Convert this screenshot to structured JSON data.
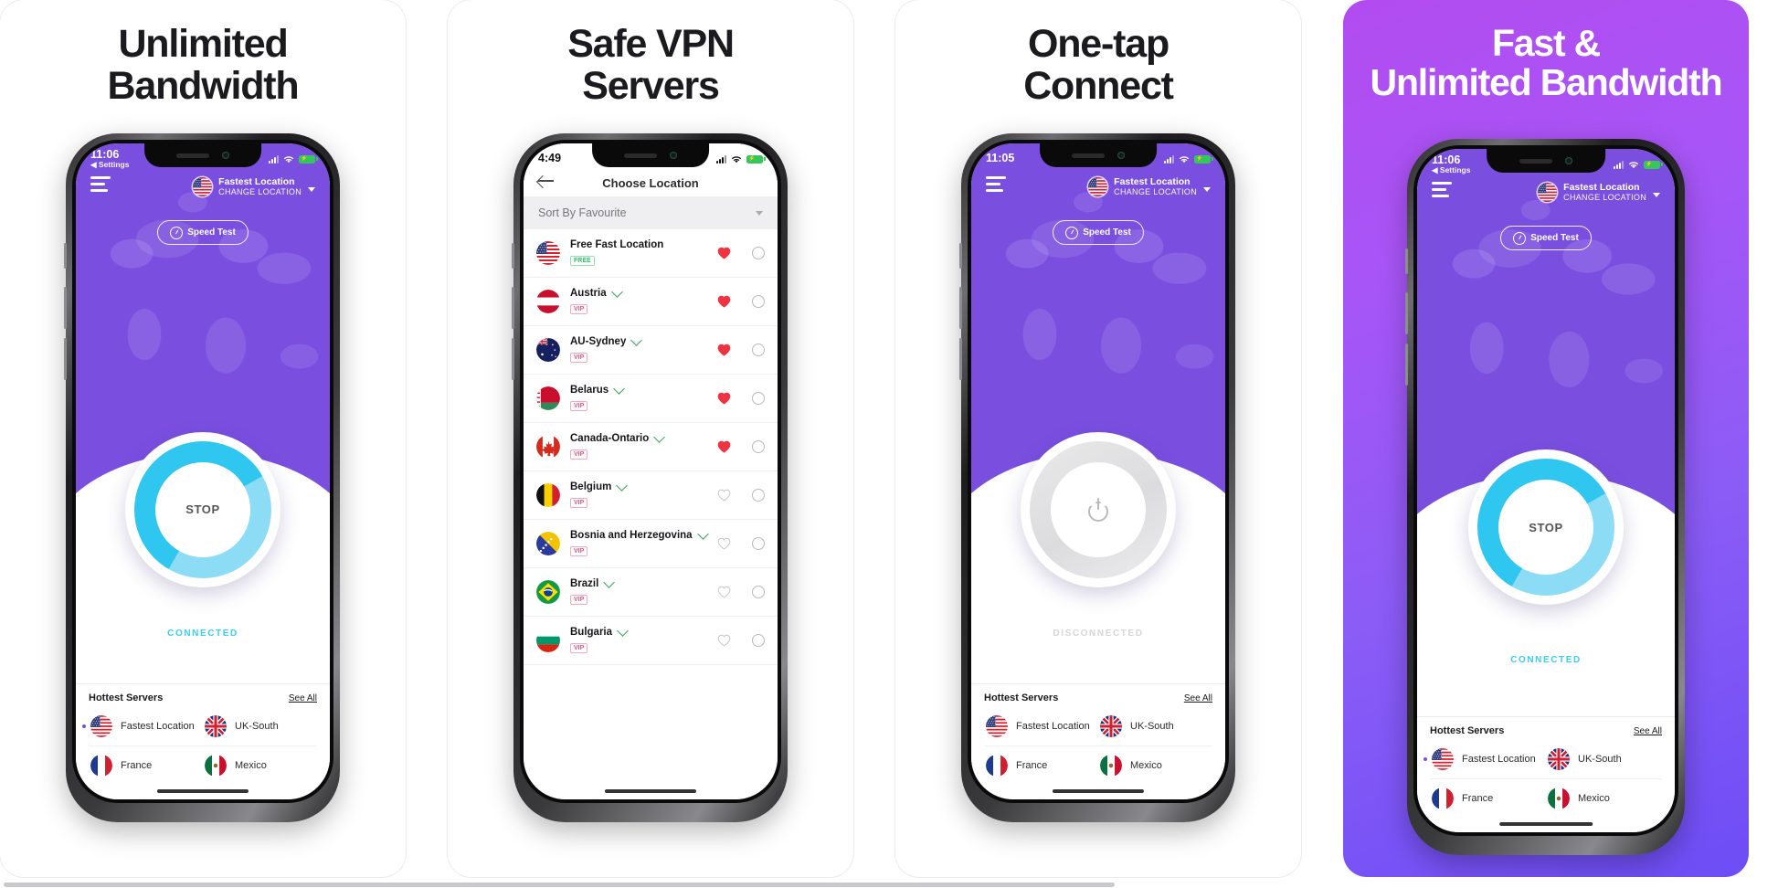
{
  "gallery": {
    "panels": [
      {
        "headline": "Unlimited\nBandwidth",
        "headline_line1": "Unlimited",
        "headline_line2": "Bandwidth",
        "screen_type": "vpn-home",
        "theme": "light",
        "status": {
          "time": "11:06",
          "back_label": "Settings",
          "battery": "charging"
        },
        "header": {
          "location_title": "Fastest Location",
          "location_sub": "CHANGE LOCATION",
          "flag": "us-flag-icon"
        },
        "speed_test_label": "Speed Test",
        "power_button_label": "STOP",
        "connection_status": "CONNECTED",
        "connection_state": "on",
        "hottest": {
          "title": "Hottest Servers",
          "see_all": "See All",
          "items": [
            {
              "name": "Fastest Location",
              "flag": "us-flag-icon",
              "active": true
            },
            {
              "name": "UK-South",
              "flag": "uk-flag-icon",
              "active": false
            },
            {
              "name": "France",
              "flag": "fr-flag-icon",
              "active": false
            },
            {
              "name": "Mexico",
              "flag": "mx-flag-icon",
              "active": false
            }
          ]
        }
      },
      {
        "headline_line1": "Safe VPN",
        "headline_line2": "Servers",
        "screen_type": "choose-location",
        "theme": "light",
        "status": {
          "time": "4:49",
          "back_label": "",
          "battery": "charging"
        },
        "nav_title": "Choose Location",
        "back_icon": "back-arrow-icon",
        "sort_label": "Sort By Favourite",
        "rows": [
          {
            "name": "Free Fast Location",
            "flag": "us-flag-icon",
            "badge": "FREE",
            "badge_type": "free",
            "chevron": false,
            "favourite": true
          },
          {
            "name": "Austria",
            "flag": "at-flag-icon",
            "badge": "VIP",
            "badge_type": "vip",
            "chevron": true,
            "favourite": true
          },
          {
            "name": "AU-Sydney",
            "flag": "au-flag-icon",
            "badge": "VIP",
            "badge_type": "vip",
            "chevron": true,
            "favourite": true
          },
          {
            "name": "Belarus",
            "flag": "by-flag-icon",
            "badge": "VIP",
            "badge_type": "vip",
            "chevron": true,
            "favourite": true
          },
          {
            "name": "Canada-Ontario",
            "flag": "ca-flag-icon",
            "badge": "VIP",
            "badge_type": "vip",
            "chevron": true,
            "favourite": true
          },
          {
            "name": "Belgium",
            "flag": "be-flag-icon",
            "badge": "VIP",
            "badge_type": "vip",
            "chevron": true,
            "favourite": false
          },
          {
            "name": "Bosnia and Herzegovina",
            "flag": "ba-flag-icon",
            "badge": "VIP",
            "badge_type": "vip",
            "chevron": true,
            "favourite": false
          },
          {
            "name": "Brazil",
            "flag": "br-flag-icon",
            "badge": "VIP",
            "badge_type": "vip",
            "chevron": true,
            "favourite": false
          },
          {
            "name": "Bulgaria",
            "flag": "bg-flag-icon",
            "badge": "VIP",
            "badge_type": "vip",
            "chevron": true,
            "favourite": false
          }
        ]
      },
      {
        "headline_line1": "One-tap",
        "headline_line2": "Connect",
        "screen_type": "vpn-home",
        "theme": "light",
        "status": {
          "time": "11:05",
          "back_label": "",
          "battery": "charging"
        },
        "header": {
          "location_title": "Fastest Location",
          "location_sub": "CHANGE LOCATION",
          "flag": "us-flag-icon"
        },
        "speed_test_label": "Speed Test",
        "power_button_label": "",
        "connection_status": "DISCONNECTED",
        "connection_state": "off",
        "hottest": {
          "title": "Hottest Servers",
          "see_all": "See All",
          "items": [
            {
              "name": "Fastest Location",
              "flag": "us-flag-icon",
              "active": false
            },
            {
              "name": "UK-South",
              "flag": "uk-flag-icon",
              "active": false
            },
            {
              "name": "France",
              "flag": "fr-flag-icon",
              "active": false
            },
            {
              "name": "Mexico",
              "flag": "mx-flag-icon",
              "active": false
            }
          ]
        }
      },
      {
        "headline_line1": "Fast &",
        "headline_line2": "Unlimited Bandwidth",
        "screen_type": "vpn-home",
        "theme": "gradient",
        "status": {
          "time": "11:06",
          "back_label": "Settings",
          "battery": "charging"
        },
        "header": {
          "location_title": "Fastest Location",
          "location_sub": "CHANGE LOCATION",
          "flag": "us-flag-icon"
        },
        "speed_test_label": "Speed Test",
        "power_button_label": "STOP",
        "connection_status": "CONNECTED",
        "connection_state": "on",
        "hottest": {
          "title": "Hottest Servers",
          "see_all": "See All",
          "items": [
            {
              "name": "Fastest Location",
              "flag": "us-flag-icon",
              "active": true
            },
            {
              "name": "UK-South",
              "flag": "uk-flag-icon",
              "active": false
            },
            {
              "name": "France",
              "flag": "fr-flag-icon",
              "active": false
            },
            {
              "name": "Mexico",
              "flag": "mx-flag-icon",
              "active": false
            }
          ]
        }
      }
    ]
  },
  "colors": {
    "purple": "#7a4fe0",
    "gradient_start": "#b24cf0",
    "gradient_end": "#6d4df6",
    "cyan": "#2fc6f0",
    "connected": "#38cff0",
    "heart_red": "#ef3340",
    "vip_pink": "#f0577f",
    "free_green": "#2fbf6b"
  }
}
